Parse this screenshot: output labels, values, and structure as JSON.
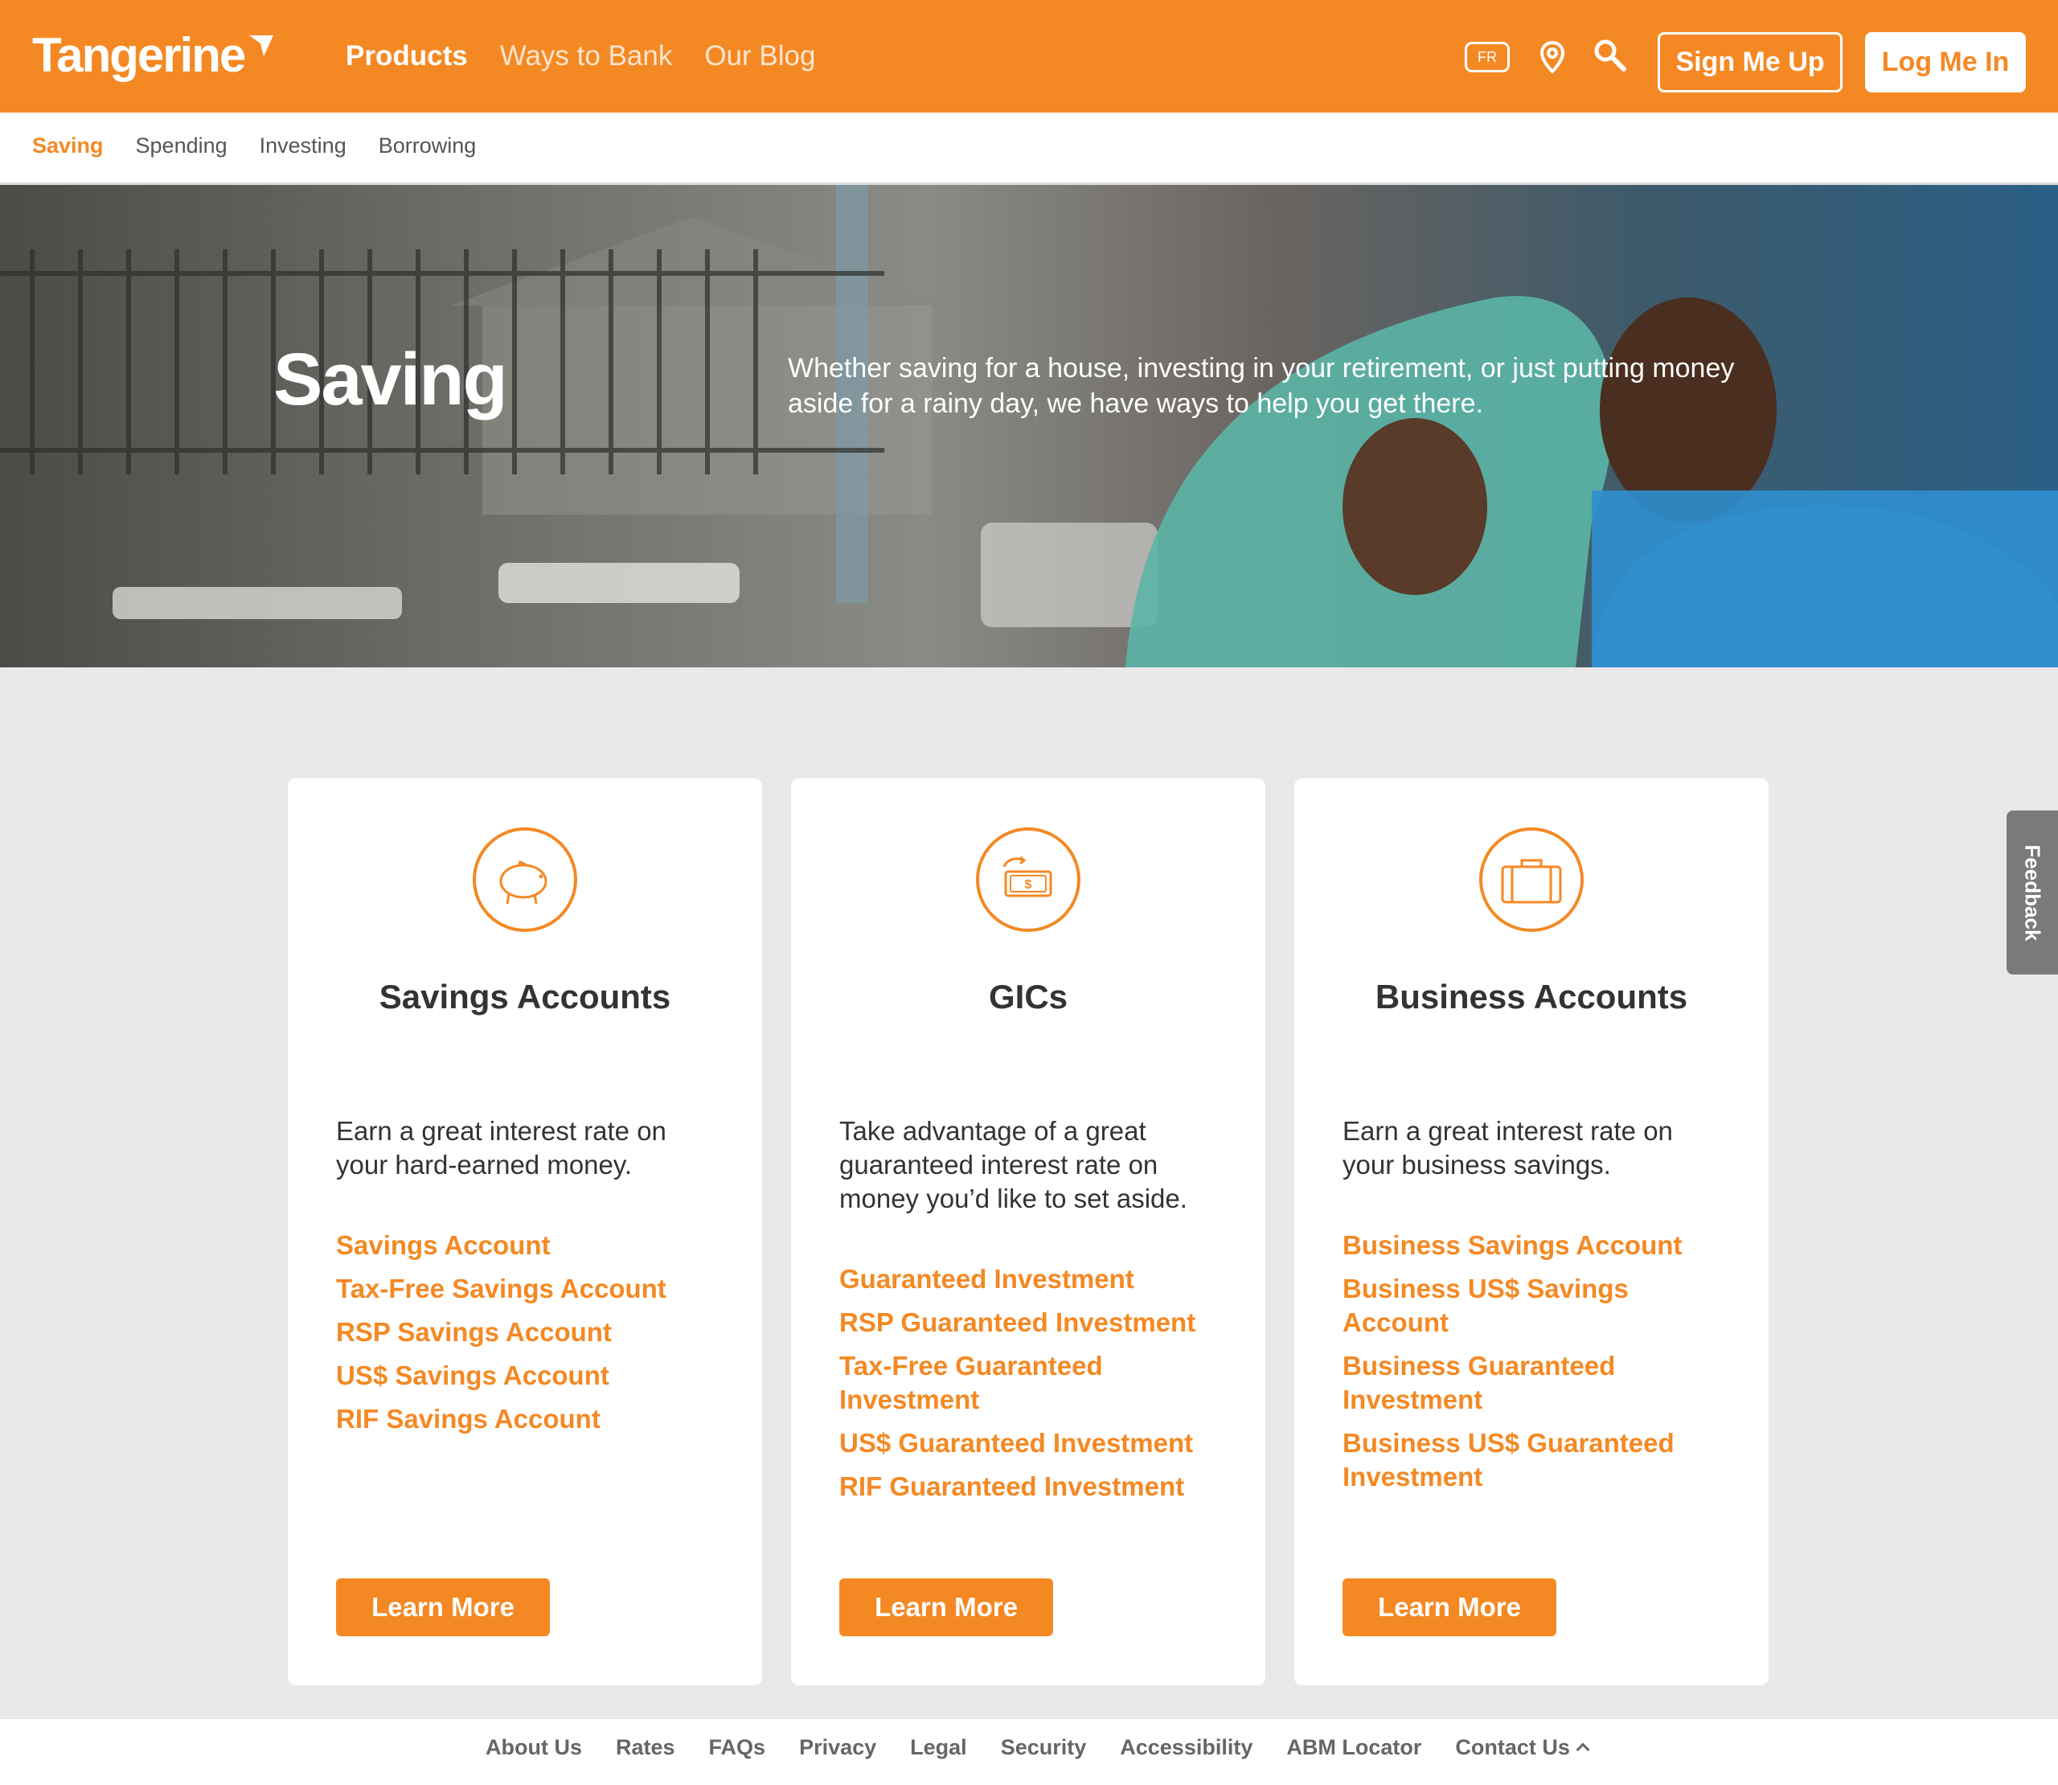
{
  "header": {
    "logo_text": "Tangerine",
    "nav": [
      "Products",
      "Ways to Bank",
      "Our Blog"
    ],
    "lang_label": "FR",
    "signup_label": "Sign Me Up",
    "login_label": "Log Me In"
  },
  "subnav": [
    "Saving",
    "Spending",
    "Investing",
    "Borrowing"
  ],
  "hero": {
    "title": "Saving",
    "text": "Whether saving for a house, investing in your retirement, or just putting money aside for a rainy day, we have ways to help you get there."
  },
  "cards": [
    {
      "icon": "piggy-bank-icon",
      "title": "Savings Accounts",
      "desc": "Earn a great interest rate on your hard-earned money.",
      "links": [
        "Savings Account",
        "Tax-Free Savings Account",
        "RSP Savings Account",
        "US$ Savings Account",
        "RIF Savings Account"
      ],
      "button": "Learn More"
    },
    {
      "icon": "money-cycle-icon",
      "title": "GICs",
      "desc": "Take advantage of a great guaranteed interest rate on money you’d like to set aside.",
      "links": [
        "Guaranteed Investment",
        "RSP Guaranteed Investment",
        "Tax-Free Guaranteed Investment",
        "US$ Guaranteed Investment",
        "RIF Guaranteed Investment"
      ],
      "button": "Learn More"
    },
    {
      "icon": "briefcase-icon",
      "title": "Business Accounts",
      "desc": "Earn a great interest rate on your business savings.",
      "links": [
        "Business Savings Account",
        "Business US$ Savings Account",
        "Business Guaranteed Investment",
        "Business US$ Guaranteed Investment"
      ],
      "button": "Learn More"
    }
  ],
  "feedback_label": "Feedback",
  "footer": [
    "About Us",
    "Rates",
    "FAQs",
    "Privacy",
    "Legal",
    "Security",
    "Accessibility",
    "ABM Locator",
    "Contact Us"
  ],
  "colors": {
    "brand": "#f48924",
    "background": "#e9e9e9"
  }
}
